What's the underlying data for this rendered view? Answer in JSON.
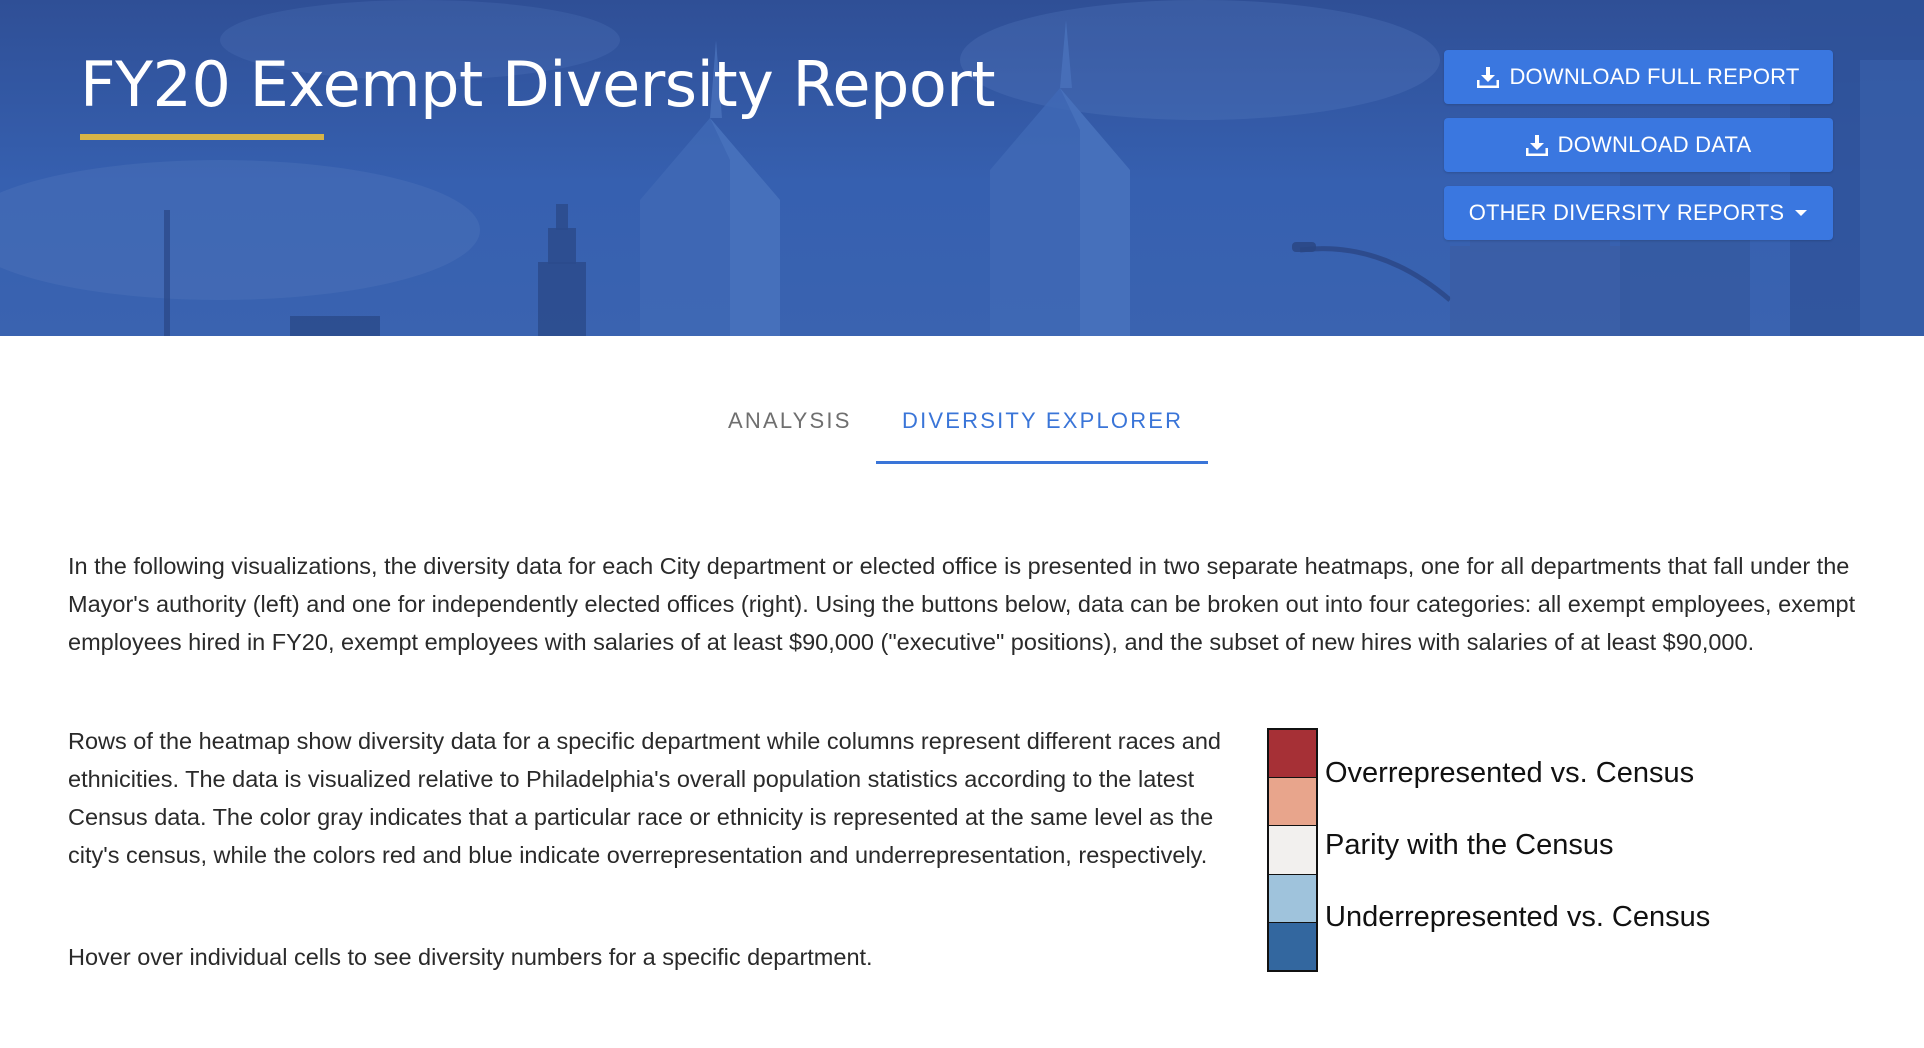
{
  "header": {
    "title": "FY20 Exempt Diversity Report",
    "buttons": {
      "download_full_report": "DOWNLOAD FULL REPORT",
      "download_data": "DOWNLOAD DATA",
      "other_reports": "OTHER DIVERSITY REPORTS"
    },
    "colors": {
      "banner": "#3660b0",
      "button": "#3a77e0",
      "title_underline": "#d7b447"
    },
    "icons": {
      "download": "download-icon",
      "dropdown": "caret-down-icon"
    }
  },
  "tabs": [
    {
      "label": "ANALYSIS",
      "active": false
    },
    {
      "label": "DIVERSITY EXPLORER",
      "active": true
    }
  ],
  "tab_active_color": "#3a75d8",
  "content": {
    "paragraph_1": "In the following visualizations, the diversity data for each City department or elected office is presented in two separate heatmaps, one for all departments that fall under the Mayor's authority (left) and one for independently elected offices (right). Using the buttons below, data can be broken out into four categories: all exempt employees, exempt employees hired in FY20, exempt employees with salaries of at least $90,000 (\"executive\" positions), and the subset of new hires with salaries of at least $90,000.",
    "paragraph_2": "Rows of the heatmap show diversity data for a specific department while columns represent different races and ethnicities. The data is visualized relative to Philadelphia's overall population statistics according to the latest Census data. The color gray indicates that a particular race or ethnicity is represented at the same level as the city's census, while the colors red and blue indicate overrepresentation and underrepresentation, respectively.",
    "paragraph_3": "Hover over individual cells to see diversity numbers for a specific department."
  },
  "legend": {
    "swatches": [
      "#a63036",
      "#e8a58c",
      "#f2f0ee",
      "#9fc3dc",
      "#33679f"
    ],
    "labels": {
      "over": "Overrepresented vs. Census",
      "parity": "Parity with the Census",
      "under": "Underrepresented vs. Census"
    }
  }
}
